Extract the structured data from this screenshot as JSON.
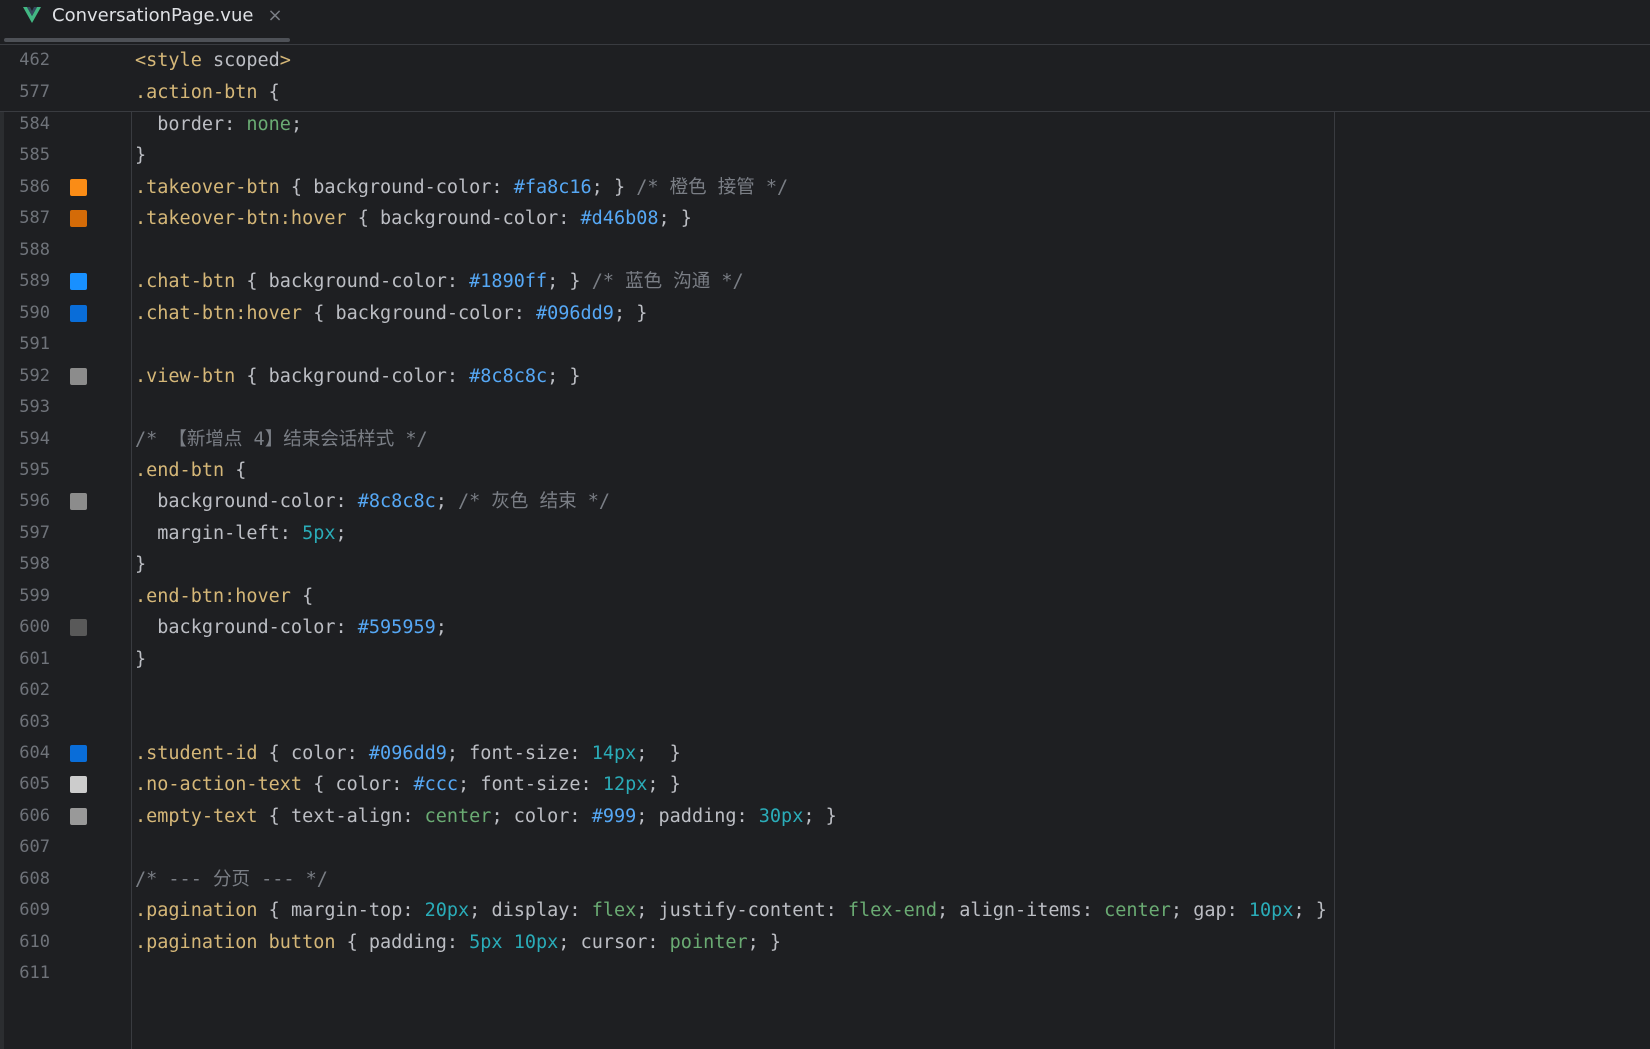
{
  "tab": {
    "title": "ConversationPage.vue",
    "close": "×",
    "icon": "vue-logo-icon"
  },
  "colors": {
    "vue_green": "#42b883",
    "vue_dark": "#35495e"
  },
  "sticky_lines": [
    {
      "num": "462",
      "tokens": [
        [
          "tag",
          "<style"
        ],
        [
          "attr",
          " scoped"
        ],
        [
          "tag",
          ">"
        ]
      ]
    },
    {
      "num": "577",
      "tokens": [
        [
          "sel",
          ".action-btn"
        ],
        [
          "pn",
          " {"
        ]
      ]
    }
  ],
  "lines": [
    {
      "num": "584",
      "tokens": [
        [
          "prop",
          "  border: "
        ],
        [
          "kw",
          "none"
        ],
        [
          "pn",
          ";"
        ]
      ]
    },
    {
      "num": "585",
      "tokens": [
        [
          "pn",
          "}"
        ]
      ]
    },
    {
      "num": "586",
      "swatch": "#fa8c16",
      "tokens": [
        [
          "sel",
          ".takeover-btn"
        ],
        [
          "pn",
          " { "
        ],
        [
          "prop",
          "background-color: "
        ],
        [
          "hex",
          "#fa8c16"
        ],
        [
          "pn",
          "; } "
        ],
        [
          "cm",
          "/* 橙色 接管 */"
        ]
      ]
    },
    {
      "num": "587",
      "swatch": "#d46b08",
      "tokens": [
        [
          "sel",
          ".takeover-btn:hover"
        ],
        [
          "pn",
          " { "
        ],
        [
          "prop",
          "background-color: "
        ],
        [
          "hex",
          "#d46b08"
        ],
        [
          "pn",
          "; }"
        ]
      ]
    },
    {
      "num": "588",
      "tokens": []
    },
    {
      "num": "589",
      "swatch": "#1890ff",
      "tokens": [
        [
          "sel",
          ".chat-btn"
        ],
        [
          "pn",
          " { "
        ],
        [
          "prop",
          "background-color: "
        ],
        [
          "hex",
          "#1890ff"
        ],
        [
          "pn",
          "; } "
        ],
        [
          "cm",
          "/* 蓝色 沟通 */"
        ]
      ]
    },
    {
      "num": "590",
      "swatch": "#096dd9",
      "tokens": [
        [
          "sel",
          ".chat-btn:hover"
        ],
        [
          "pn",
          " { "
        ],
        [
          "prop",
          "background-color: "
        ],
        [
          "hex",
          "#096dd9"
        ],
        [
          "pn",
          "; }"
        ]
      ]
    },
    {
      "num": "591",
      "tokens": []
    },
    {
      "num": "592",
      "swatch": "#8c8c8c",
      "tokens": [
        [
          "sel",
          ".view-btn"
        ],
        [
          "pn",
          " { "
        ],
        [
          "prop",
          "background-color: "
        ],
        [
          "hex",
          "#8c8c8c"
        ],
        [
          "pn",
          "; }"
        ]
      ]
    },
    {
      "num": "593",
      "tokens": []
    },
    {
      "num": "594",
      "tokens": [
        [
          "cm",
          "/* 【新增点 4】结束会话样式 */"
        ]
      ]
    },
    {
      "num": "595",
      "tokens": [
        [
          "sel",
          ".end-btn"
        ],
        [
          "pn",
          " {"
        ]
      ]
    },
    {
      "num": "596",
      "swatch": "#8c8c8c",
      "tokens": [
        [
          "prop",
          "  background-color: "
        ],
        [
          "hex",
          "#8c8c8c"
        ],
        [
          "pn",
          "; "
        ],
        [
          "cm",
          "/* 灰色 结束 */"
        ]
      ]
    },
    {
      "num": "597",
      "tokens": [
        [
          "prop",
          "  margin-left: "
        ],
        [
          "num",
          "5px"
        ],
        [
          "pn",
          ";"
        ]
      ]
    },
    {
      "num": "598",
      "tokens": [
        [
          "pn",
          "}"
        ]
      ]
    },
    {
      "num": "599",
      "tokens": [
        [
          "sel",
          ".end-btn:hover"
        ],
        [
          "pn",
          " {"
        ]
      ]
    },
    {
      "num": "600",
      "swatch": "#595959",
      "tokens": [
        [
          "prop",
          "  background-color: "
        ],
        [
          "hex",
          "#595959"
        ],
        [
          "pn",
          ";"
        ]
      ]
    },
    {
      "num": "601",
      "tokens": [
        [
          "pn",
          "}"
        ]
      ]
    },
    {
      "num": "602",
      "tokens": []
    },
    {
      "num": "603",
      "tokens": []
    },
    {
      "num": "604",
      "swatch": "#096dd9",
      "tokens": [
        [
          "sel",
          ".student-id"
        ],
        [
          "pn",
          " { "
        ],
        [
          "prop",
          "color: "
        ],
        [
          "hex",
          "#096dd9"
        ],
        [
          "pn",
          "; "
        ],
        [
          "prop",
          "font-size: "
        ],
        [
          "num",
          "14px"
        ],
        [
          "pn",
          ";  }"
        ]
      ]
    },
    {
      "num": "605",
      "swatch": "#cccccc",
      "tokens": [
        [
          "sel",
          ".no-action-text"
        ],
        [
          "pn",
          " { "
        ],
        [
          "prop",
          "color: "
        ],
        [
          "hex",
          "#ccc"
        ],
        [
          "pn",
          "; "
        ],
        [
          "prop",
          "font-size: "
        ],
        [
          "num",
          "12px"
        ],
        [
          "pn",
          "; }"
        ]
      ]
    },
    {
      "num": "606",
      "swatch": "#999999",
      "tokens": [
        [
          "sel",
          ".empty-text"
        ],
        [
          "pn",
          " { "
        ],
        [
          "prop",
          "text-align: "
        ],
        [
          "kw",
          "center"
        ],
        [
          "pn",
          "; "
        ],
        [
          "prop",
          "color: "
        ],
        [
          "hex",
          "#999"
        ],
        [
          "pn",
          "; "
        ],
        [
          "prop",
          "padding: "
        ],
        [
          "num",
          "30px"
        ],
        [
          "pn",
          "; }"
        ]
      ]
    },
    {
      "num": "607",
      "tokens": []
    },
    {
      "num": "608",
      "tokens": [
        [
          "cm",
          "/* --- 分页 --- */"
        ]
      ]
    },
    {
      "num": "609",
      "tokens": [
        [
          "sel",
          ".pagination"
        ],
        [
          "pn",
          " { "
        ],
        [
          "prop",
          "margin-top: "
        ],
        [
          "num",
          "20px"
        ],
        [
          "pn",
          "; "
        ],
        [
          "prop",
          "display: "
        ],
        [
          "kw",
          "flex"
        ],
        [
          "pn",
          "; "
        ],
        [
          "prop",
          "justify-content: "
        ],
        [
          "kw",
          "flex-end"
        ],
        [
          "pn",
          "; "
        ],
        [
          "prop",
          "align-items: "
        ],
        [
          "kw",
          "center"
        ],
        [
          "pn",
          "; "
        ],
        [
          "prop",
          "gap: "
        ],
        [
          "num",
          "10px"
        ],
        [
          "pn",
          "; }"
        ]
      ]
    },
    {
      "num": "610",
      "tokens": [
        [
          "sel",
          ".pagination button"
        ],
        [
          "pn",
          " { "
        ],
        [
          "prop",
          "padding: "
        ],
        [
          "num",
          "5px"
        ],
        [
          "pn",
          " "
        ],
        [
          "num",
          "10px"
        ],
        [
          "pn",
          "; "
        ],
        [
          "prop",
          "cursor: "
        ],
        [
          "kw",
          "pointer"
        ],
        [
          "pn",
          "; }"
        ]
      ]
    },
    {
      "num": "611",
      "tokens": []
    }
  ]
}
